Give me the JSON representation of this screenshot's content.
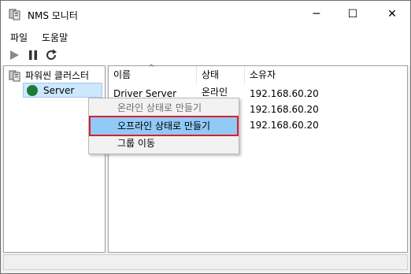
{
  "window": {
    "title": "NMS 모니터",
    "controls": {
      "minimize": "─",
      "maximize": "☐",
      "close": "✕"
    }
  },
  "menu": {
    "file": "파일",
    "help": "도움말"
  },
  "toolbar": {
    "play": "play-icon",
    "pause": "pause-icon",
    "refresh": "refresh-icon"
  },
  "tree": {
    "root": "파워씬 클러스터",
    "child": "Server",
    "child_status_color": "#1e7a3a"
  },
  "list": {
    "columns": [
      "이름",
      "상태",
      "소유자"
    ],
    "rows": [
      {
        "name": "Driver Server",
        "status": "온라인",
        "owner": "192.168.60.20"
      },
      {
        "name": "",
        "status": "",
        "owner": "192.168.60.20"
      },
      {
        "name": "",
        "status": "",
        "owner": "192.168.60.20"
      }
    ]
  },
  "context_menu": {
    "items": [
      {
        "label": "온라인 상태로 만들기",
        "state": "disabled"
      },
      {
        "label": "오프라인 상태로 만들기",
        "state": "highlighted"
      },
      {
        "label": "그룹 이동",
        "state": "normal"
      }
    ]
  },
  "colors": {
    "selection": "#cce8ff",
    "menu_highlight": "#91c9f7",
    "callout_border": "#d9202b"
  }
}
